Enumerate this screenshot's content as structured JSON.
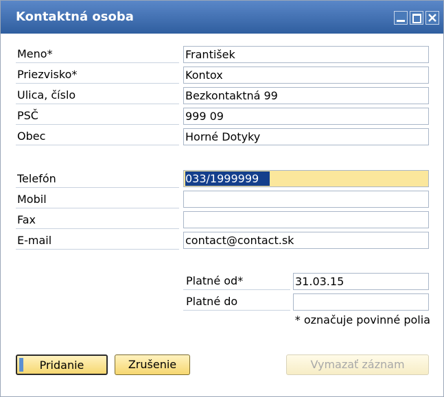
{
  "window": {
    "title": "Kontaktná osoba",
    "colors": {
      "titlebar": "#3a69ad",
      "active_field": "#fbe79c",
      "button": "#f6d770"
    }
  },
  "form": {
    "fields": [
      {
        "label": "Meno*",
        "value": "František"
      },
      {
        "label": "Priezvisko*",
        "value": "Kontox"
      },
      {
        "label": "Ulica, číslo",
        "value": "Bezkontaktná 99"
      },
      {
        "label": "PSČ",
        "value": "999 09"
      },
      {
        "label": "Obec",
        "value": "Horné Dotyky"
      },
      {
        "label": "Telefón",
        "value": "033/1999999"
      },
      {
        "label": "Mobil",
        "value": ""
      },
      {
        "label": "Fax",
        "value": ""
      },
      {
        "label": "E-mail",
        "value": "contact@contact.sk"
      }
    ],
    "validity": [
      {
        "label": "Platné od*",
        "value": "31.03.15"
      },
      {
        "label": "Platné do",
        "value": ""
      }
    ],
    "required_note": "* označuje povinné polia"
  },
  "buttons": {
    "add": "Pridanie",
    "cancel": "Zrušenie",
    "delete": "Vymazať záznam"
  },
  "icons": [
    "minimize-icon",
    "maximize-icon",
    "close-icon"
  ]
}
